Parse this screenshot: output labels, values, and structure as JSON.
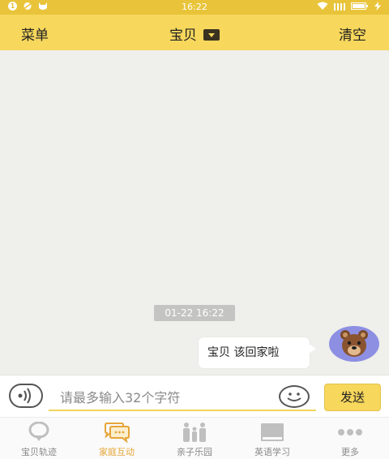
{
  "status_bar": {
    "time": "16:22",
    "notification_count": "1"
  },
  "header": {
    "menu_label": "菜单",
    "title": "宝贝",
    "clear_label": "清空"
  },
  "chat": {
    "timestamp": "01-22 16:22",
    "messages": [
      {
        "text": "宝贝 该回家啦",
        "avatar": "bear-icon"
      }
    ]
  },
  "input_bar": {
    "placeholder": "请最多输入32个字符",
    "send_label": "发送"
  },
  "tabs": [
    {
      "label": "宝贝轨迹",
      "icon": "location-pin-icon",
      "active": false
    },
    {
      "label": "家庭互动",
      "icon": "chat-bubbles-icon",
      "active": true
    },
    {
      "label": "亲子乐园",
      "icon": "family-icon",
      "active": false
    },
    {
      "label": "英语学习",
      "icon": "book-icon",
      "active": false
    },
    {
      "label": "更多",
      "icon": "more-icon",
      "active": false
    }
  ],
  "colors": {
    "status_bar": "#e9c43a",
    "header": "#f7d75c",
    "active_tab": "#e6a538",
    "avatar_bg": "#8d8fe3"
  }
}
